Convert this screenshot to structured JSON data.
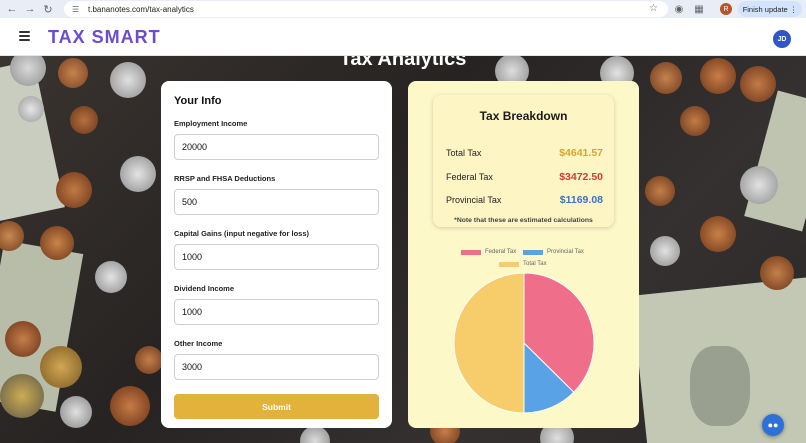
{
  "browser": {
    "url": "t.banano​tes.com/tax-analytics",
    "profile_initial": "R",
    "update_label": "Finish update"
  },
  "app": {
    "brand": "TAX SMART",
    "avatar_initials": "JD",
    "page_title": "Tax Analytics"
  },
  "info_form": {
    "title": "Your Info",
    "fields": [
      {
        "label": "Employment Income",
        "value": "20000"
      },
      {
        "label": "RRSP and FHSA Deductions",
        "value": "500"
      },
      {
        "label": "Capital Gains (input negative for loss)",
        "value": "1000"
      },
      {
        "label": "Dividend Income",
        "value": "1000"
      },
      {
        "label": "Other Income",
        "value": "3000"
      }
    ],
    "submit_label": "Submit"
  },
  "breakdown": {
    "title": "Tax Breakdown",
    "rows": [
      {
        "label": "Total Tax",
        "value": "$4641.57",
        "color": "#d9a431"
      },
      {
        "label": "Federal Tax",
        "value": "$3472.50",
        "color": "#d43a3a"
      },
      {
        "label": "Provincial Tax",
        "value": "$1169.08",
        "color": "#3a6fd4"
      }
    ],
    "note": "*Note that these are estimated calculations"
  },
  "chart_data": {
    "type": "pie",
    "legend": [
      "Federal Tax",
      "Provincial Tax",
      "Total Tax"
    ],
    "series": [
      {
        "name": "Federal Tax",
        "value": 3472.5,
        "color": "#ef6f8a"
      },
      {
        "name": "Provincial Tax",
        "value": 1169.08,
        "color": "#5aa2e6"
      },
      {
        "name": "Total Tax",
        "value": 4641.57,
        "color": "#f6cd6a"
      }
    ]
  }
}
